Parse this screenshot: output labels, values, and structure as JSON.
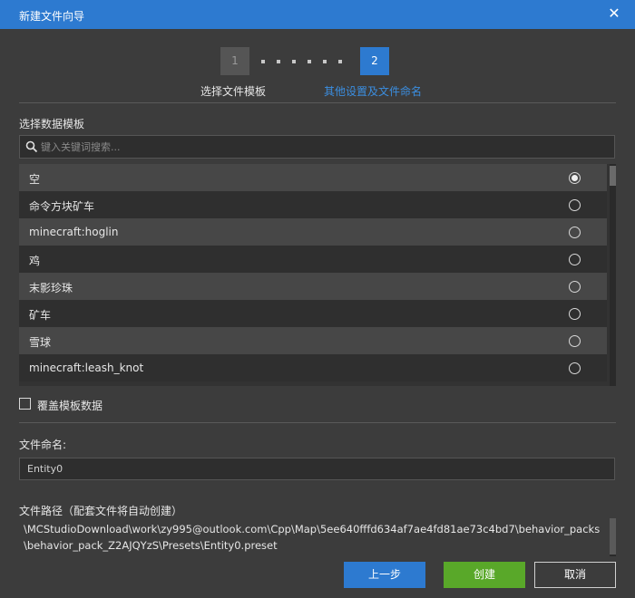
{
  "window": {
    "title": "新建文件向导",
    "close_icon": "close-icon"
  },
  "stepper": {
    "steps": [
      {
        "number": "1",
        "label": "选择文件模板",
        "state": "completed"
      },
      {
        "number": "2",
        "label": "其他设置及文件命名",
        "state": "active"
      }
    ],
    "active_color": "#2d7ad0"
  },
  "template": {
    "section_label": "选择数据模板",
    "search": {
      "placeholder": "键入关键词搜索...",
      "value": "",
      "icon": "search-icon"
    },
    "items": [
      {
        "label": "空",
        "selected": true
      },
      {
        "label": "命令方块矿车",
        "selected": false
      },
      {
        "label": "minecraft:hoglin",
        "selected": false
      },
      {
        "label": "鸡",
        "selected": false
      },
      {
        "label": "末影珍珠",
        "selected": false
      },
      {
        "label": "矿车",
        "selected": false
      },
      {
        "label": "雪球",
        "selected": false
      },
      {
        "label": "minecraft:leash_knot",
        "selected": false
      }
    ],
    "override": {
      "label": "覆盖模板数据",
      "checked": false
    }
  },
  "naming": {
    "label": "文件命名:",
    "value": "Entity0"
  },
  "path": {
    "label": "文件路径（配套文件将自动创建）",
    "value": "\\MCStudioDownload\\work\\zy995@outlook.com\\Cpp\\Map\\5ee640fffd634af7ae4fd81ae73c4bd7\\behavior_packs\\behavior_pack_Z2AJQYzS\\Presets\\Entity0.preset"
  },
  "buttons": {
    "prev": "上一步",
    "create": "创建",
    "cancel": "取消"
  },
  "colors": {
    "titlebar": "#2d7ad0",
    "primary_button": "#2d7ad0",
    "create_button": "#59a829",
    "background": "#3c3c3c"
  }
}
